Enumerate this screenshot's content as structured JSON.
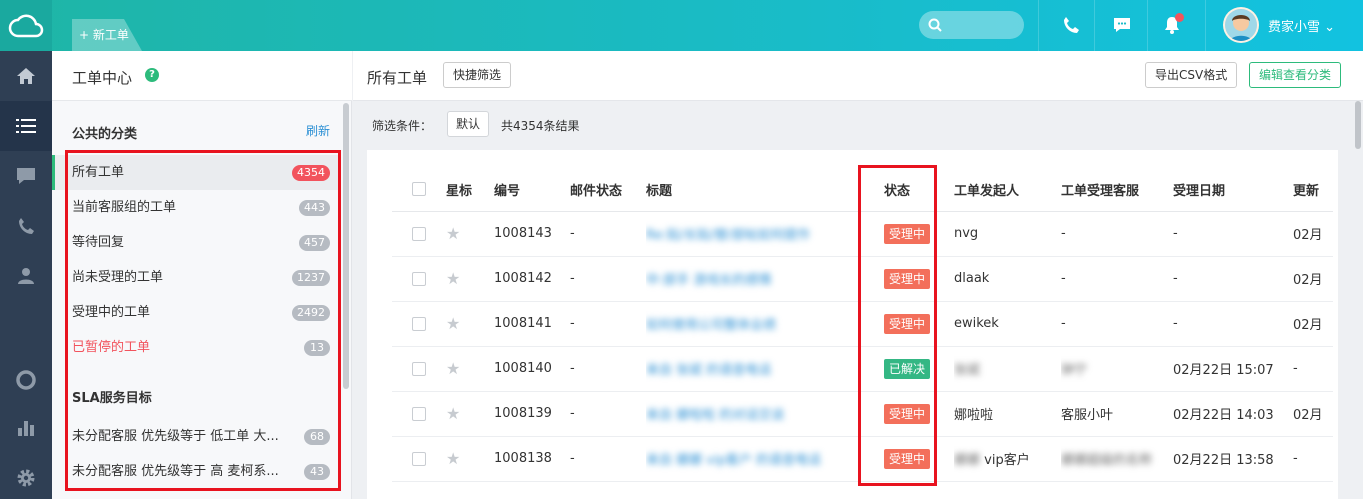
{
  "topbar": {
    "new_ticket": "+ 新工单",
    "username": "费家小雪",
    "caret": "⌄",
    "search_placeholder": ""
  },
  "icons": {
    "logo": "cloud-logo-icon",
    "nav": [
      "home-icon",
      "list-icon",
      "chat-icon",
      "phone-icon",
      "user-icon",
      "lifebuoy-icon",
      "bar-chart-icon",
      "gear-icon"
    ]
  },
  "sidebar": {
    "title": "工单中心",
    "help": "?",
    "public_section": "公共的分类",
    "refresh": "刷新",
    "items": [
      {
        "label": "所有工单",
        "count": "4354"
      },
      {
        "label": "当前客服组的工单",
        "count": "443"
      },
      {
        "label": "等待回复",
        "count": "457"
      },
      {
        "label": "尚未受理的工单",
        "count": "1237"
      },
      {
        "label": "受理中的工单",
        "count": "2492"
      },
      {
        "label": "已暂停的工单",
        "count": "13"
      }
    ],
    "sla_section": "SLA服务目标",
    "sla_items": [
      {
        "label": "未分配客服 优先级等于 低工单 大...",
        "count": "68"
      },
      {
        "label": "未分配客服 优先级等于 高 麦柯系...",
        "count": "43"
      }
    ]
  },
  "main": {
    "title": "所有工单",
    "quick_filter": "快捷筛选",
    "export_csv": "导出CSV格式",
    "edit_view": "编辑查看分类",
    "filter_label": "筛选条件：",
    "filter_default": "默认",
    "total": "共4354条结果"
  },
  "table": {
    "headers": [
      "",
      "星标",
      "编号",
      "邮件状态",
      "标题",
      "状态",
      "工单发起人",
      "工单受理客服",
      "受理日期",
      "更新"
    ],
    "rows": [
      {
        "star": "★",
        "id": "1008143",
        "mail": "-",
        "title": "Re:贴/长贴/替/部帖如何提作",
        "status": "受理中",
        "status_color": "#f36f5b",
        "requester": "nvg",
        "requester_blur": false,
        "agent": "-",
        "agent_blur": false,
        "date": "-",
        "updated": "02月"
      },
      {
        "star": "★",
        "id": "1008142",
        "mail": "-",
        "title": "中:部手 游戏长的感情",
        "status": "受理中",
        "status_color": "#f36f5b",
        "requester": "dlaak",
        "requester_blur": false,
        "agent": "-",
        "agent_blur": false,
        "date": "-",
        "updated": "02月"
      },
      {
        "star": "★",
        "id": "1008141",
        "mail": "-",
        "title": "如何使用公司整体业绩",
        "status": "受理中",
        "status_color": "#f36f5b",
        "requester": "ewikek",
        "requester_blur": false,
        "agent": "-",
        "agent_blur": false,
        "date": "-",
        "updated": "02月"
      },
      {
        "star": "★",
        "id": "1008140",
        "mail": "-",
        "title": "来自 张斌 的语音电话",
        "status": "已解决",
        "status_color": "#34b784",
        "requester": "张斌",
        "requester_blur": true,
        "agent": "钟宁",
        "agent_blur": true,
        "date": "02月22日 15:07",
        "updated": "-"
      },
      {
        "star": "★",
        "id": "1008139",
        "mail": "-",
        "title": "来自 娜啦啦 的对话交谈",
        "status": "受理中",
        "status_color": "#f36f5b",
        "requester": "娜啦啦",
        "requester_blur": false,
        "agent": "客服小叶",
        "agent_blur": false,
        "date": "02月22日 14:03",
        "updated": "02月"
      },
      {
        "star": "★",
        "id": "1008138",
        "mail": "-",
        "title": "来自 娜娜 vip客户 的语音电话",
        "status": "受理中",
        "status_color": "#f36f5b",
        "requester": "娜娜 vip客户",
        "requester_blur": "partial",
        "agent": "娜娜超级的名称",
        "agent_blur": true,
        "date": "02月22日 13:58",
        "updated": "-"
      }
    ]
  }
}
